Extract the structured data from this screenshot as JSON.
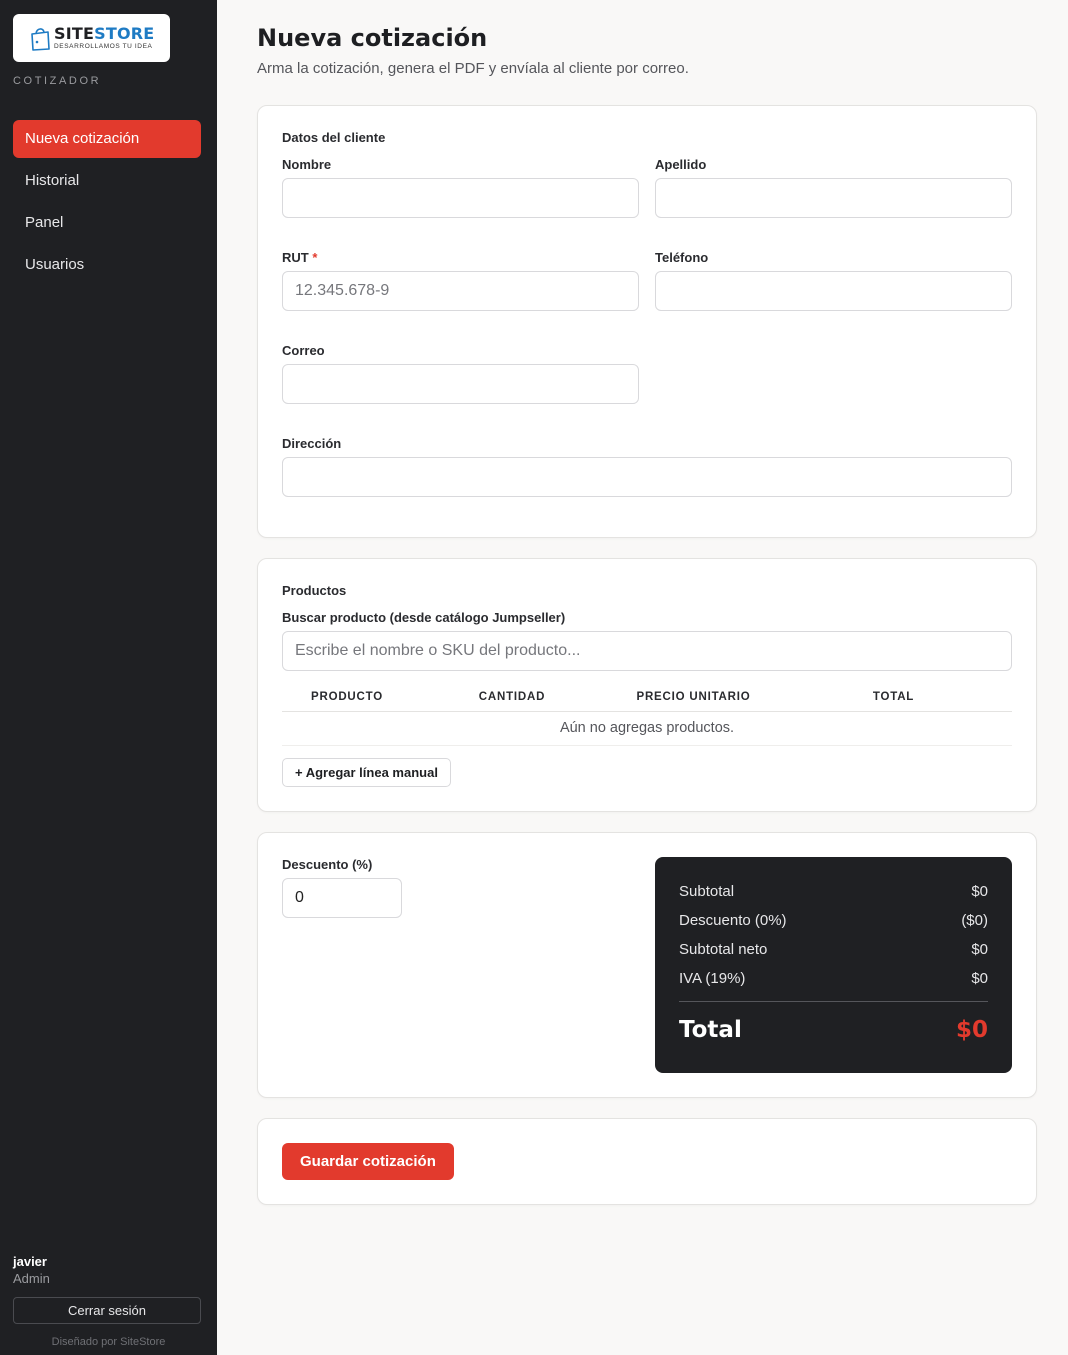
{
  "brand": {
    "name_part1": "SITE",
    "name_part2": "STORE",
    "tagline": "DESARROLLAMOS TU IDEA",
    "section": "COTIZADOR",
    "accent_color": "#e23a2d",
    "logo_blue": "#1e7bc4"
  },
  "nav": {
    "items": [
      {
        "label": "Nueva cotización",
        "active": true
      },
      {
        "label": "Historial",
        "active": false
      },
      {
        "label": "Panel",
        "active": false
      },
      {
        "label": "Usuarios",
        "active": false
      }
    ]
  },
  "user": {
    "name": "javier",
    "role": "Admin",
    "logout_label": "Cerrar sesión",
    "credit": "Diseñado por SiteStore"
  },
  "header": {
    "title": "Nueva cotización",
    "subtitle": "Arma la cotización, genera el PDF y envíala al cliente por correo."
  },
  "client": {
    "section_title": "Datos del cliente",
    "nombre": {
      "label": "Nombre",
      "value": "",
      "placeholder": ""
    },
    "apellido": {
      "label": "Apellido",
      "value": "",
      "placeholder": ""
    },
    "rut": {
      "label": "RUT",
      "required_mark": "*",
      "value": "",
      "placeholder": "12.345.678-9"
    },
    "telefono": {
      "label": "Teléfono",
      "value": "",
      "placeholder": ""
    },
    "correo": {
      "label": "Correo",
      "value": "",
      "placeholder": ""
    },
    "direccion": {
      "label": "Dirección",
      "value": "",
      "placeholder": ""
    }
  },
  "products": {
    "section_title": "Productos",
    "search_label": "Buscar producto (desde catálogo Jumpseller)",
    "search_placeholder": "Escribe el nombre o SKU del producto...",
    "columns": [
      "PRODUCTO",
      "CANTIDAD",
      "PRECIO UNITARIO",
      "TOTAL"
    ],
    "empty_text": "Aún no agregas productos.",
    "add_line_label": "+ Agregar línea manual"
  },
  "discount": {
    "label": "Descuento (%)",
    "value": "0"
  },
  "totals": {
    "subtotal": {
      "label": "Subtotal",
      "value": "$0"
    },
    "descuento": {
      "label": "Descuento (0%)",
      "value": "($0)"
    },
    "subtotal_neto": {
      "label": "Subtotal neto",
      "value": "$0"
    },
    "iva": {
      "label": "IVA (19%)",
      "value": "$0"
    },
    "total": {
      "label": "Total",
      "value": "$0"
    }
  },
  "actions": {
    "save_label": "Guardar cotización"
  }
}
